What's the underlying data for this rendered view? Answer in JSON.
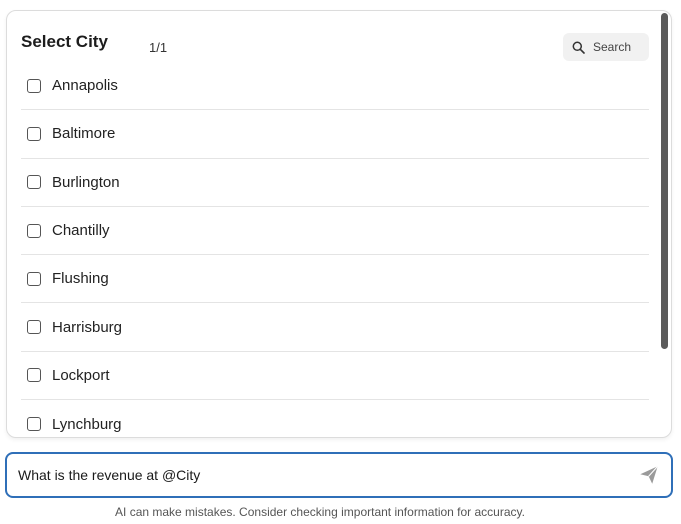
{
  "panel": {
    "title": "Select City",
    "page_count": "1/1",
    "search_label": "Search",
    "items": [
      {
        "label": "Annapolis"
      },
      {
        "label": "Baltimore"
      },
      {
        "label": "Burlington"
      },
      {
        "label": "Chantilly"
      },
      {
        "label": "Flushing"
      },
      {
        "label": "Harrisburg"
      },
      {
        "label": "Lockport"
      },
      {
        "label": "Lynchburg"
      }
    ]
  },
  "chat": {
    "input_value": "What is the revenue at @City",
    "send_icon": "send-icon"
  },
  "footer": {
    "disclaimer": "AI can make mistakes. Consider checking important information for accuracy."
  },
  "colors": {
    "input_border": "#2f6fb8",
    "scrollbar": "#5b5b5b"
  }
}
